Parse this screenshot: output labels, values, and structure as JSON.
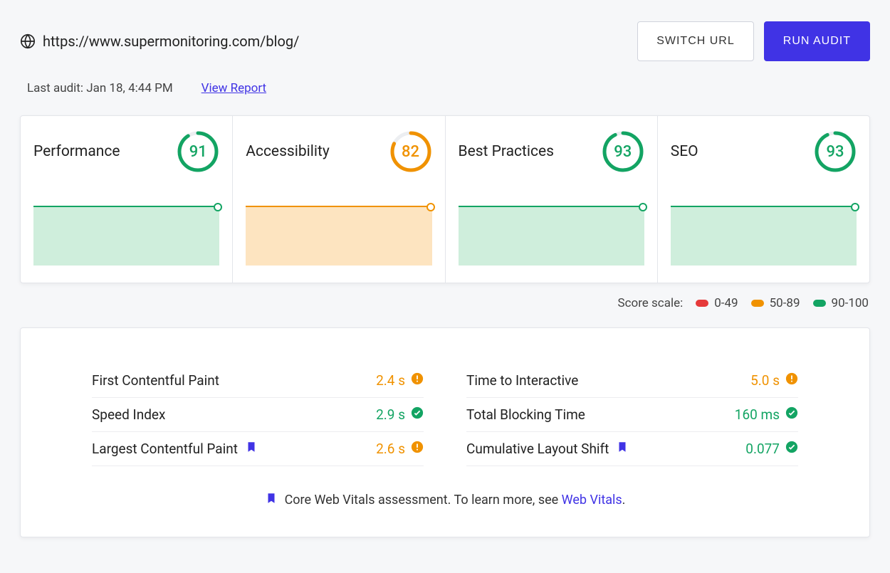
{
  "header": {
    "url": "https://www.supermonitoring.com/blog/",
    "switch_label": "SWITCH URL",
    "run_label": "RUN AUDIT"
  },
  "subheader": {
    "last_audit": "Last audit: Jan 18, 4:44 PM",
    "view_report": "View Report"
  },
  "scores": [
    {
      "label": "Performance",
      "value": 91,
      "color": "green"
    },
    {
      "label": "Accessibility",
      "value": 82,
      "color": "orange"
    },
    {
      "label": "Best Practices",
      "value": 93,
      "color": "green"
    },
    {
      "label": "SEO",
      "value": 93,
      "color": "green"
    }
  ],
  "scale": {
    "label": "Score scale:",
    "red": "0-49",
    "orange": "50-89",
    "green": "90-100"
  },
  "metrics": {
    "left": [
      {
        "name": "First Contentful Paint",
        "value": "2.4 s",
        "status": "warn",
        "flag": false
      },
      {
        "name": "Speed Index",
        "value": "2.9 s",
        "status": "ok",
        "flag": false
      },
      {
        "name": "Largest Contentful Paint",
        "value": "2.6 s",
        "status": "warn",
        "flag": true
      }
    ],
    "right": [
      {
        "name": "Time to Interactive",
        "value": "5.0 s",
        "status": "warn",
        "flag": false
      },
      {
        "name": "Total Blocking Time",
        "value": "160 ms",
        "status": "ok",
        "flag": false
      },
      {
        "name": "Cumulative Layout Shift",
        "value": "0.077",
        "status": "ok",
        "flag": true
      }
    ]
  },
  "footer": {
    "text": "Core Web Vitals assessment. To learn more, see ",
    "link_text": "Web Vitals",
    "suffix": "."
  },
  "colors": {
    "green": "#13a463",
    "orange": "#f09200",
    "blue": "#4033e5"
  }
}
